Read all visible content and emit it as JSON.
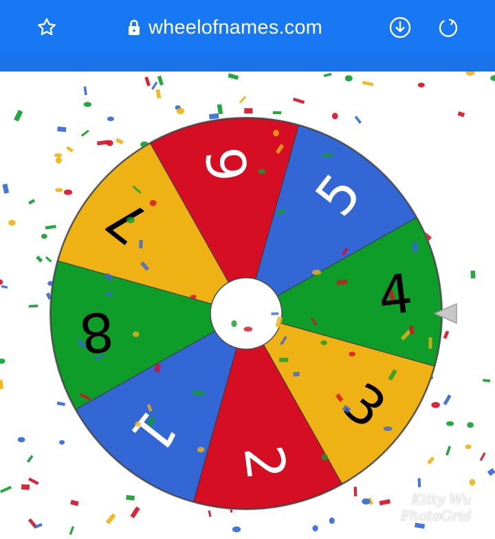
{
  "browser": {
    "url": "wheelofnames.com",
    "bar_color": "#1877f2",
    "icons": {
      "bookmark": "star-outline-icon",
      "secure": "lock-icon",
      "download": "download-circle-icon",
      "reload": "reload-icon"
    }
  },
  "wheel": {
    "segments": [
      {
        "label": "4",
        "color": "#0f9d2a",
        "text_color": "#000000"
      },
      {
        "label": "3",
        "color": "#eeb214",
        "text_color": "#000000"
      },
      {
        "label": "2",
        "color": "#d60e24",
        "text_color": "#ffffff"
      },
      {
        "label": "1",
        "color": "#3367d6",
        "text_color": "#ffffff"
      },
      {
        "label": "8",
        "color": "#0f9d2a",
        "text_color": "#000000"
      },
      {
        "label": "7",
        "color": "#eeb214",
        "text_color": "#000000"
      },
      {
        "label": "6",
        "color": "#d60e24",
        "text_color": "#ffffff"
      },
      {
        "label": "5",
        "color": "#3367d6",
        "text_color": "#ffffff"
      }
    ],
    "pointer_color": "#c8c8c8"
  },
  "watermark": {
    "line1": "Kitty Wu",
    "line2": "PhotoGrid"
  }
}
